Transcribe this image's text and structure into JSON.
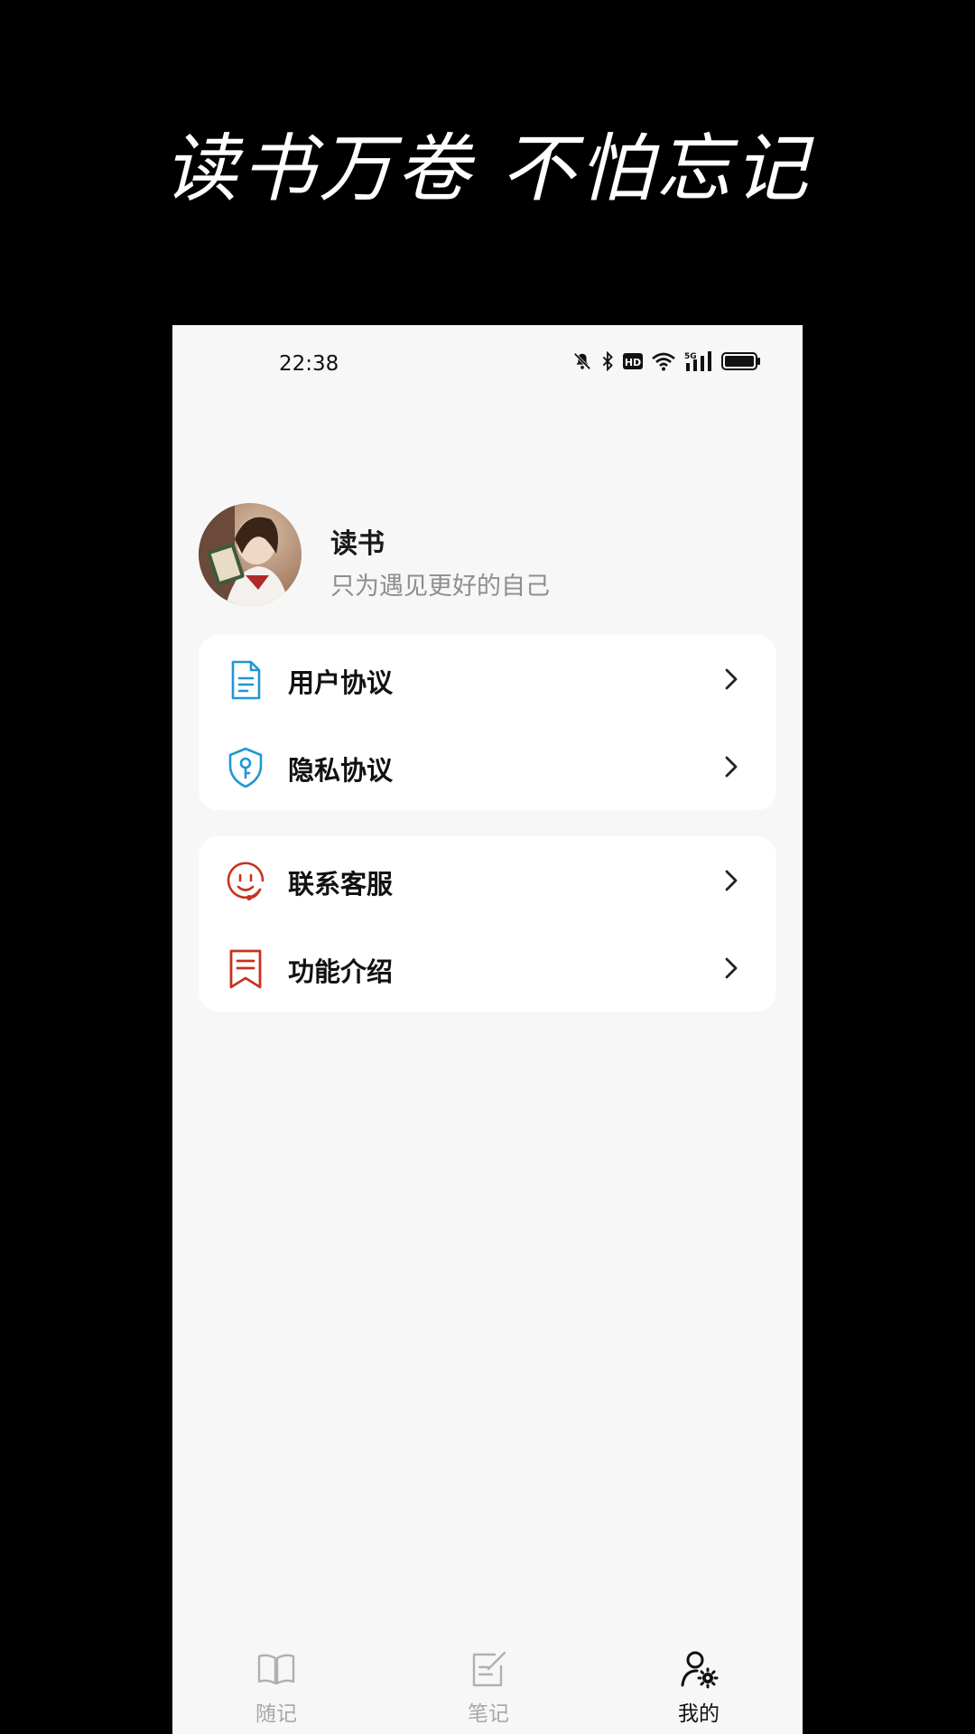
{
  "promo": {
    "title": "读书万卷 不怕忘记"
  },
  "status_bar": {
    "time": "22:38",
    "network_label": "5G",
    "hd_label": "HD"
  },
  "profile": {
    "name": "读书",
    "motto": "只为遇见更好的自己"
  },
  "menu_groups": [
    {
      "items": [
        {
          "label": "用户协议",
          "icon": "document-icon",
          "color": "#2196d3"
        },
        {
          "label": "隐私协议",
          "icon": "shield-key-icon",
          "color": "#2196d3"
        }
      ]
    },
    {
      "items": [
        {
          "label": "联系客服",
          "icon": "smiley-headset-icon",
          "color": "#c8321e"
        },
        {
          "label": "功能介绍",
          "icon": "bookmark-icon",
          "color": "#c8321e"
        }
      ]
    }
  ],
  "bottom_nav": {
    "items": [
      {
        "label": "随记",
        "icon": "book-icon",
        "active": false
      },
      {
        "label": "笔记",
        "icon": "edit-note-icon",
        "active": false
      },
      {
        "label": "我的",
        "icon": "user-settings-icon",
        "active": true
      }
    ]
  }
}
